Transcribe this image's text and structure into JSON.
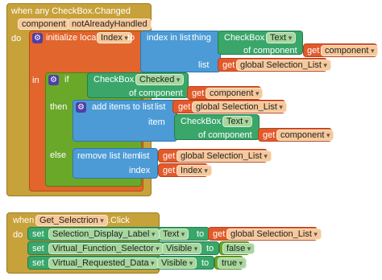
{
  "event1": {
    "header": "when any CheckBox.Changed",
    "params": [
      "component",
      "notAlreadyHandled"
    ],
    "do_label": "do",
    "init_local": {
      "label": "initialize local",
      "var": "Index",
      "to": "to"
    },
    "index_in_list": {
      "label": "index in list",
      "thing_label": "thing",
      "list_label": "list"
    },
    "checkbox_text_1": {
      "component": "CheckBox",
      "dot": ".",
      "property": "Text",
      "of_component": "of component"
    },
    "get_component_1": {
      "get": "get",
      "var": "component"
    },
    "get_selection_list_1": {
      "get": "get",
      "var": "global Selection_List"
    },
    "in_label": "in",
    "if_block": {
      "if": "if",
      "then": "then",
      "else": "else"
    },
    "checkbox_checked": {
      "component": "CheckBox",
      "dot": ".",
      "property": "Checked",
      "of_component": "of component"
    },
    "get_component_2": {
      "get": "get",
      "var": "component"
    },
    "add_items": {
      "label": "add items to list",
      "list_label": "list",
      "item_label": "item"
    },
    "get_selection_list_2": {
      "get": "get",
      "var": "global Selection_List"
    },
    "checkbox_text_2": {
      "component": "CheckBox",
      "dot": ".",
      "property": "Text",
      "of_component": "of component"
    },
    "get_component_3": {
      "get": "get",
      "var": "component"
    },
    "remove_item": {
      "label": "remove list item",
      "list_label": "list",
      "index_label": "index"
    },
    "get_selection_list_3": {
      "get": "get",
      "var": "global Selection_List"
    },
    "get_index": {
      "get": "get",
      "var": "Index"
    }
  },
  "event2": {
    "when": "when",
    "component": "Get_Selectrion",
    "event": ".Click",
    "do_label": "do",
    "set1": {
      "set": "set",
      "component": "Selection_Display_Label",
      "dot": ".",
      "property": "Text",
      "to": "to",
      "get": "get",
      "var": "global Selection_List"
    },
    "set2": {
      "set": "set",
      "component": "Virtual_Function_Selector",
      "dot": ".",
      "property": "Visible",
      "to": "to",
      "value": "false"
    },
    "set3": {
      "set": "set",
      "component": "Virtual_Requested_Data",
      "dot": ".",
      "property": "Visible",
      "to": "to",
      "value": "true"
    }
  }
}
